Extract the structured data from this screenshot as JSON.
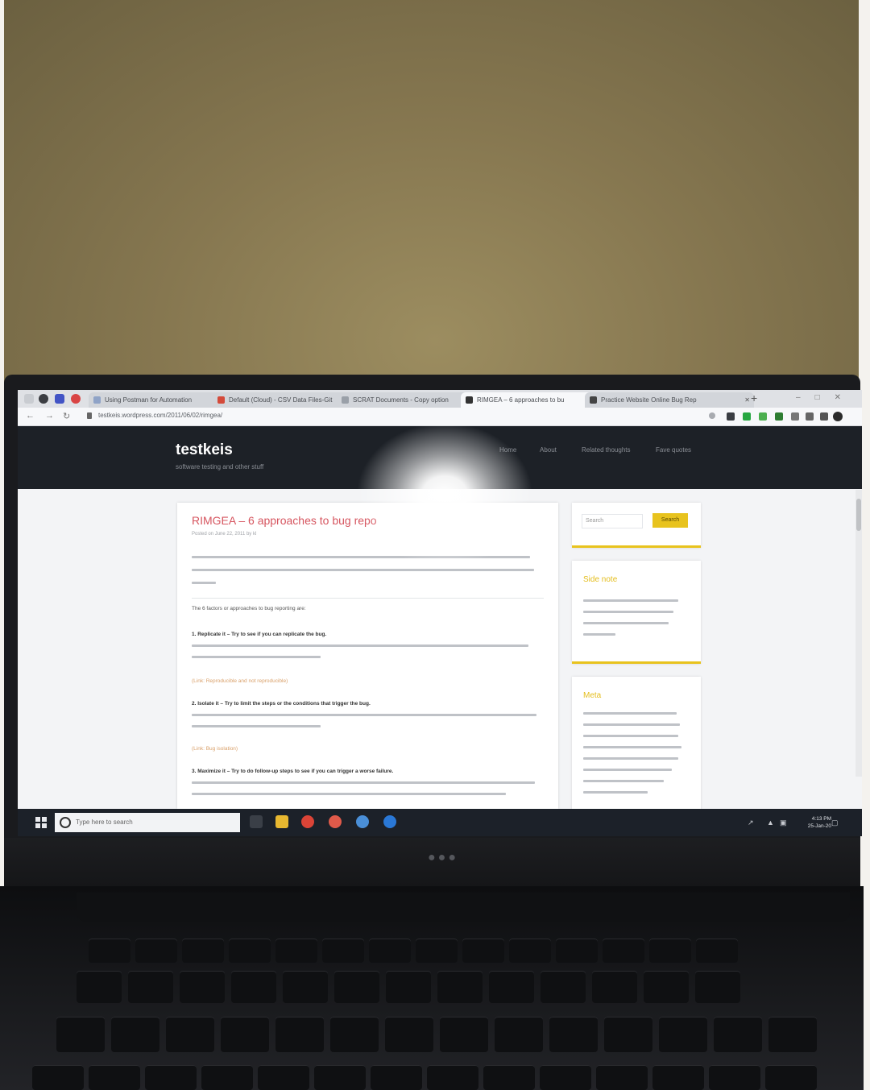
{
  "browser": {
    "tabs": [
      {
        "label": "Using Postman for Automation",
        "active": false,
        "color": "#3a66c5"
      },
      {
        "label": "Default (Cloud) - CSV Data Files-Git",
        "active": false,
        "color": "#d44a3a"
      },
      {
        "label": "SCRAT Documents - Copy option",
        "active": false,
        "color": "#6a7078"
      },
      {
        "label": "RIMGEA – 6 approaches to bu",
        "active": true,
        "color": "#333333"
      },
      {
        "label": "Practice Website Online Bug Rep",
        "active": false,
        "color": "#4a4a4a"
      }
    ],
    "url": "testkeis.wordpress.com/2011/06/02/rimgea/",
    "new_tab": "+"
  },
  "site": {
    "title": "testkeis",
    "tagline": "software testing and other stuff",
    "nav": [
      "Home",
      "About",
      "Related thoughts",
      "Fave quotes"
    ]
  },
  "post": {
    "title": "RIMGEA – 6 approaches to bug repo",
    "meta": "Posted on June 22, 2011 by kl",
    "factors_intro": "The 6 factors or approaches to bug reporting are:",
    "step1": "1. Replicate it – Try to see if you can replicate the bug.",
    "link1": "(Link: Reproducible and not reproducible)",
    "step2": "2. Isolate it – Try to limit the steps or the conditions that trigger the bug.",
    "link2": "(Link: Bug isolation)",
    "step3": "3. Maximize it – Try to do follow-up steps to see if you can trigger a worse failure."
  },
  "sidebar": {
    "search_placeholder": "Search",
    "search_button": "Search",
    "widget1_title": "Side note",
    "widget2_title": "Meta"
  },
  "taskbar": {
    "search_placeholder": "Type here to search",
    "time": "4:13 PM",
    "date": "25-Jan-20"
  },
  "colors": {
    "accent_yellow": "#e8c31e",
    "title_red": "#d6555f",
    "header_dark": "#1d2127"
  }
}
